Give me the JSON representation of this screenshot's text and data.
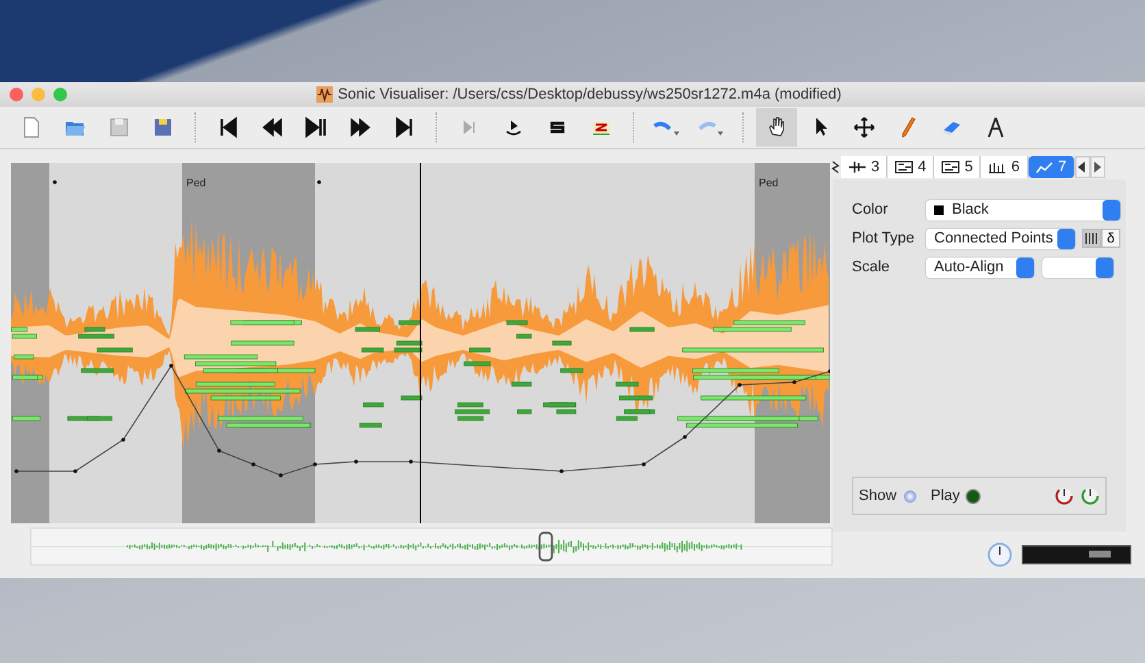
{
  "window": {
    "title": "Sonic Visualiser: /Users/css/Desktop/debussy/ws250sr1272.m4a (modified)"
  },
  "toolbar": {
    "tools": [
      {
        "kind": "hand",
        "selected": true
      },
      {
        "kind": "arrow",
        "selected": false
      },
      {
        "kind": "move",
        "selected": false
      },
      {
        "kind": "pencil",
        "selected": false
      },
      {
        "kind": "eraser",
        "selected": false
      },
      {
        "kind": "measure",
        "selected": false
      }
    ]
  },
  "pane": {
    "pedal_labels": [
      "Ped",
      "Ped"
    ]
  },
  "layer_tabs": [
    {
      "label": "3",
      "kind": "instants",
      "selected": false
    },
    {
      "label": "4",
      "kind": "notes",
      "selected": false
    },
    {
      "label": "5",
      "kind": "notes",
      "selected": false
    },
    {
      "label": "6",
      "kind": "bars",
      "selected": false
    },
    {
      "label": "7",
      "kind": "curve",
      "selected": true
    }
  ],
  "properties": {
    "color": {
      "label": "Color",
      "value": "Black"
    },
    "plot_type": {
      "label": "Plot Type",
      "value": "Connected Points"
    },
    "plot_toggles": [
      {
        "kind": "bars",
        "selected": true
      },
      {
        "kind": "text",
        "label": "δ",
        "selected": false
      }
    ],
    "scale": {
      "label": "Scale",
      "value": "Auto-Align"
    }
  },
  "layer_controls": {
    "show": {
      "label": "Show",
      "on": true
    },
    "play": {
      "label": "Play",
      "on": true
    }
  },
  "speed_slider": {
    "level": 0.72
  }
}
